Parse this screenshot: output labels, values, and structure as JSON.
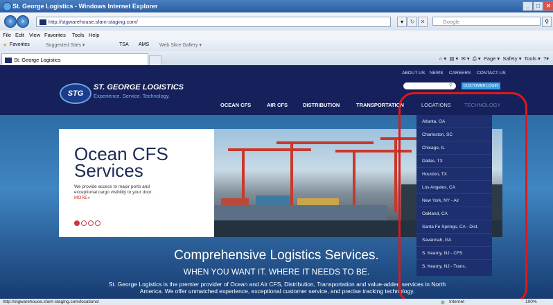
{
  "window": {
    "title": "St. George Logistics - Windows Internet Explorer"
  },
  "address_bar": {
    "url": "http://stgwarehouse.sfam-staging.com/",
    "search_placeholder": "Google"
  },
  "menu": {
    "items": [
      "File",
      "Edit",
      "View",
      "Favorites",
      "Tools",
      "Help"
    ]
  },
  "favorites_bar": {
    "favorites_label": "Favorites",
    "links": [
      "Suggested Sites ▾",
      "TSA",
      "AMS",
      "Web Slice Gallery ▾"
    ]
  },
  "tab": {
    "label": "St. George Logistics"
  },
  "command_bar": {
    "page": "Page ▾",
    "safety": "Safety ▾",
    "tools": "Tools ▾"
  },
  "site": {
    "logo_text": "STG",
    "name": "ST. GEORGE LOGISTICS",
    "tagline": "Experience. Service. Technology.",
    "util_links": [
      "ABOUT US",
      "NEWS",
      "CAREERS",
      "CONTACT US"
    ],
    "customer_login": "CUSTOMER LOGIN",
    "nav": [
      "OCEAN CFS",
      "AIR CFS",
      "DISTRIBUTION",
      "TRANSPORTATION",
      "LOCATIONS",
      "TECHNOLOGY"
    ],
    "locations": [
      "Atlanta, GA",
      "Charleston, SC",
      "Chicago, IL",
      "Dallas, TX",
      "Houston, TX",
      "Los Angeles, CA",
      "New York, NY - Air",
      "Oakland, CA",
      "Santa Fe Springs, CA - Dist.",
      "Savannah, GA",
      "S. Kearny, NJ - CFS",
      "S. Kearny, NJ - Trans."
    ]
  },
  "hero": {
    "slide_title_1": "Ocean CFS",
    "slide_title_2": "Services",
    "slide_text": "We provide access to major ports and exceptional cargo visibility to your door.",
    "slide_more": "MORE»",
    "slides_total": 4,
    "slides_active": 1,
    "headline": "Comprehensive Logistics Services.",
    "subheadline": "WHEN YOU WANT IT. WHERE IT NEEDS TO BE.",
    "body": "St. George Logistics is the premier provider of Ocean and Air CFS, Distribution, Transportation and value-added services in North America. We offer unmatched experience, exceptional customer service, and precise tracking technology."
  },
  "status_bar": {
    "url": "http://stgwarehouse.sfam-staging.com/locations/",
    "zone": "Internet",
    "zoom": "100%"
  },
  "colors": {
    "header_bg": "#16215c",
    "accent_blue": "#3aa0e6",
    "highlight_circle": "#e01818"
  }
}
